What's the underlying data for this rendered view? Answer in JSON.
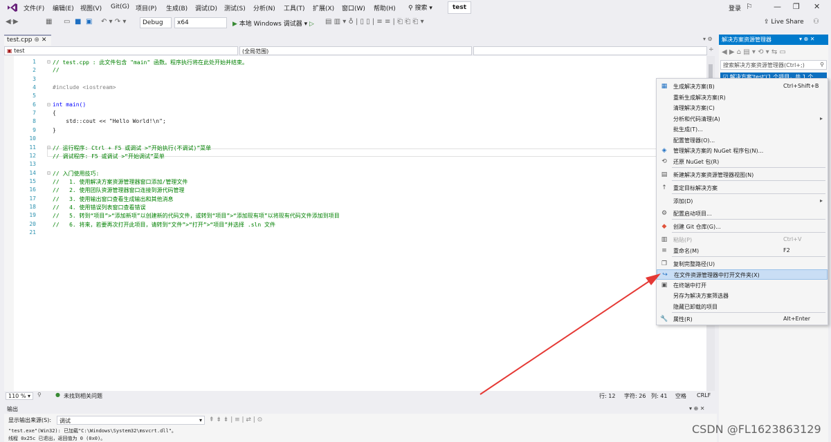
{
  "menu": {
    "items": [
      "文件(F)",
      "编辑(E)",
      "视图(V)",
      "Git(G)",
      "项目(P)",
      "生成(B)",
      "调试(D)",
      "测试(S)",
      "分析(N)",
      "工具(T)",
      "扩展(X)",
      "窗口(W)",
      "帮助(H)"
    ],
    "search": "搜索",
    "solution_title": "test",
    "login": "登录",
    "live_share": "Live Share"
  },
  "toolbar": {
    "config": "Debug",
    "platform": "x64",
    "run_label": "本地 Windows 调试器"
  },
  "editor": {
    "tab_label": "test.cpp",
    "nav_left": "test",
    "nav_mid": "(全局范围)",
    "lines": [
      {
        "n": "1",
        "t": "// test.cpp : 此文件包含 \"main\" 函数。程序执行将在此处开始并结束。"
      },
      {
        "n": "2",
        "t": "//"
      },
      {
        "n": "3",
        "t": ""
      },
      {
        "n": "4",
        "t": "#include <iostream>"
      },
      {
        "n": "5",
        "t": ""
      },
      {
        "n": "6",
        "t": "int main()"
      },
      {
        "n": "7",
        "t": "{"
      },
      {
        "n": "8",
        "t": "    std::cout << \"Hello World!\\n\";"
      },
      {
        "n": "9",
        "t": "}"
      },
      {
        "n": "10",
        "t": ""
      },
      {
        "n": "11",
        "t": "// 运行程序: Ctrl + F5 或调试 >“开始执行(不调试)”菜单"
      },
      {
        "n": "12",
        "t": "// 调试程序: F5 或调试 >“开始调试”菜单"
      },
      {
        "n": "13",
        "t": ""
      },
      {
        "n": "14",
        "t": "// 入门使用技巧:"
      },
      {
        "n": "15",
        "t": "//   1. 使用解决方案资源管理器窗口添加/管理文件"
      },
      {
        "n": "16",
        "t": "//   2. 使用团队资源管理器窗口连接到源代码管理"
      },
      {
        "n": "17",
        "t": "//   3. 使用输出窗口查看生成输出和其他消息"
      },
      {
        "n": "18",
        "t": "//   4. 使用错误列表窗口查看错误"
      },
      {
        "n": "19",
        "t": "//   5. 转到“项目”>“添加新项”以创建新的代码文件，或转到“项目”>“添加现有项”以将现有代码文件添加到项目"
      },
      {
        "n": "20",
        "t": "//   6. 将来，若要再次打开此项目，请转到“文件”>“打开”>“项目”并选择 .sln 文件"
      },
      {
        "n": "21",
        "t": ""
      }
    ]
  },
  "status": {
    "zoom": "110 %",
    "issues": "未找到相关问题",
    "row": "行: 12",
    "char": "字符: 26",
    "col": "列: 41",
    "space": "空格",
    "crlf": "CRLF"
  },
  "output": {
    "title": "输出",
    "source_label": "显示输出来源(S):",
    "source_value": "调试",
    "line1": "\"test.exe\"(Win32): 已加载\"C:\\Windows\\System32\\msvcrt.dll\"。",
    "line2": "线程 0x25c 已退出，返回值为 0 (0x0)。"
  },
  "solution_explorer": {
    "title": "解决方案资源管理器",
    "search_placeholder": "搜索解决方案资源管理器(Ctrl+;)",
    "selected_item": "解决方案'test'(1 个项目，共 1 个"
  },
  "context_menu": [
    {
      "label": "生成解决方案(B)",
      "shortcut": "Ctrl+Shift+B",
      "icon": "build-icon"
    },
    {
      "label": "重新生成解决方案(R)",
      "shortcut": "",
      "icon": ""
    },
    {
      "label": "清理解决方案(C)",
      "shortcut": "",
      "icon": ""
    },
    {
      "label": "分析和代码清理(A)",
      "shortcut": "",
      "icon": "",
      "submenu": true
    },
    {
      "label": "批生成(T)...",
      "shortcut": "",
      "icon": ""
    },
    {
      "label": "配置管理器(O)...",
      "shortcut": "",
      "icon": ""
    },
    {
      "label": "管理解决方案的 NuGet 程序包(N)...",
      "shortcut": "",
      "icon": "nuget-icon"
    },
    {
      "label": "还原 NuGet 包(R)",
      "shortcut": "",
      "icon": "restore-icon"
    },
    {
      "label": "新建解决方案资源管理器视图(N)",
      "shortcut": "",
      "icon": "new-view-icon"
    },
    {
      "label": "重定目标解决方案",
      "shortcut": "",
      "icon": "retarget-icon"
    },
    {
      "label": "添加(D)",
      "shortcut": "",
      "icon": "",
      "submenu": true
    },
    {
      "label": "配置启动项目...",
      "shortcut": "",
      "icon": "gear-icon"
    },
    {
      "label": "创建 Git 仓库(G)...",
      "shortcut": "",
      "icon": "git-icon"
    },
    {
      "label": "粘贴(P)",
      "shortcut": "Ctrl+V",
      "icon": "paste-icon",
      "disabled": true
    },
    {
      "label": "重命名(M)",
      "shortcut": "F2",
      "icon": "rename-icon"
    },
    {
      "label": "复制完整路径(U)",
      "shortcut": "",
      "icon": "copy-icon"
    },
    {
      "label": "在文件资源管理器中打开文件夹(X)",
      "shortcut": "",
      "icon": "open-folder-icon",
      "highlight": true
    },
    {
      "label": "在终端中打开",
      "shortcut": "",
      "icon": "terminal-icon"
    },
    {
      "label": "另存为解决方案筛选器",
      "shortcut": "",
      "icon": ""
    },
    {
      "label": "隐藏已卸载的项目",
      "shortcut": "",
      "icon": ""
    },
    {
      "label": "属性(R)",
      "shortcut": "Alt+Enter",
      "icon": "wrench-icon"
    }
  ],
  "watermark": "CSDN @FL1623863129",
  "colors": {
    "accent": "#007acc",
    "arrow": "#e53935",
    "highlight": "#c9def5"
  }
}
